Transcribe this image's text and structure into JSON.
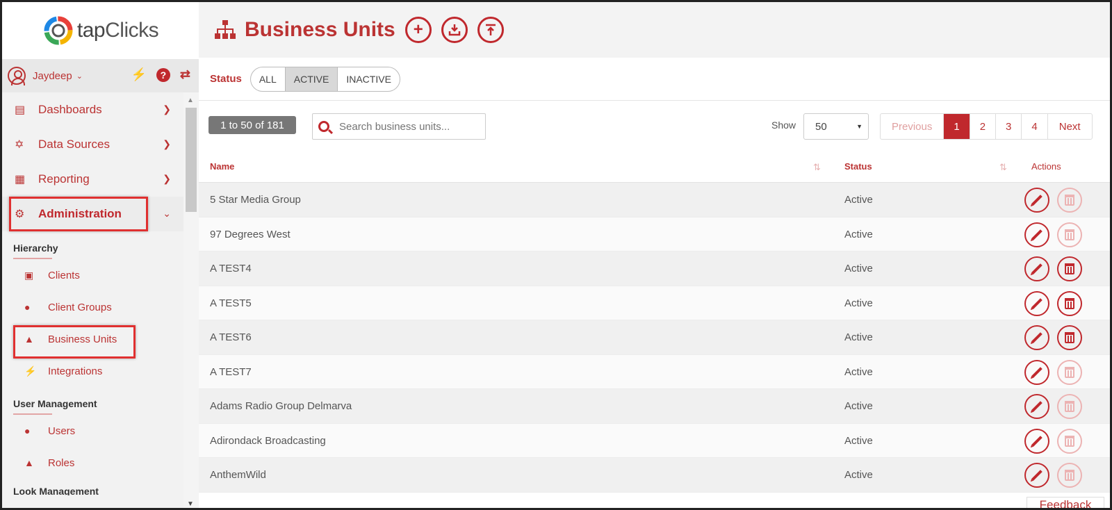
{
  "brand": {
    "name_prefix": "tap",
    "name_suffix": "Clicks"
  },
  "user": {
    "name": "Jaydeep",
    "help_glyph": "?"
  },
  "nav": {
    "main": [
      {
        "label": "Dashboards",
        "icon": "line-chart-icon"
      },
      {
        "label": "Data Sources",
        "icon": "plug-icon"
      },
      {
        "label": "Reporting",
        "icon": "report-icon"
      },
      {
        "label": "Administration",
        "icon": "gear-icon",
        "active": true
      }
    ],
    "hierarchy_title": "Hierarchy",
    "hierarchy": [
      {
        "label": "Clients",
        "icon": "briefcase-icon"
      },
      {
        "label": "Client Groups",
        "icon": "users-icon"
      },
      {
        "label": "Business Units",
        "icon": "sitemap-icon"
      },
      {
        "label": "Integrations",
        "icon": "plug-icon"
      }
    ],
    "user_mgmt_title": "User Management",
    "user_mgmt": [
      {
        "label": "Users",
        "icon": "user-icon"
      },
      {
        "label": "Roles",
        "icon": "sitemap-icon"
      }
    ],
    "next_section_partial": "Look Management"
  },
  "page": {
    "title": "Business Units"
  },
  "status_filter": {
    "label": "Status",
    "options": [
      "ALL",
      "ACTIVE",
      "INACTIVE"
    ],
    "selected": "ACTIVE"
  },
  "controls": {
    "count": "1 to 50 of 181",
    "search_placeholder": "Search business units...",
    "show_label": "Show",
    "show_value": "50",
    "pagination": {
      "previous": "Previous",
      "pages": [
        "1",
        "2",
        "3",
        "4"
      ],
      "current": "1",
      "next": "Next"
    }
  },
  "table": {
    "headers": {
      "name": "Name",
      "status": "Status",
      "actions": "Actions"
    },
    "rows": [
      {
        "name": "5 Star Media Group",
        "status": "Active",
        "deletable": false
      },
      {
        "name": "97 Degrees West",
        "status": "Active",
        "deletable": false
      },
      {
        "name": "A TEST4",
        "status": "Active",
        "deletable": true
      },
      {
        "name": "A TEST5",
        "status": "Active",
        "deletable": true
      },
      {
        "name": "A TEST6",
        "status": "Active",
        "deletable": true
      },
      {
        "name": "A TEST7",
        "status": "Active",
        "deletable": false
      },
      {
        "name": "Adams Radio Group Delmarva",
        "status": "Active",
        "deletable": false
      },
      {
        "name": "Adirondack Broadcasting",
        "status": "Active",
        "deletable": false
      },
      {
        "name": "AnthemWild",
        "status": "Active",
        "deletable": false
      }
    ]
  },
  "feedback_label": "Feedback",
  "colors": {
    "accent": "#c0282d",
    "highlight": "#e03030"
  }
}
